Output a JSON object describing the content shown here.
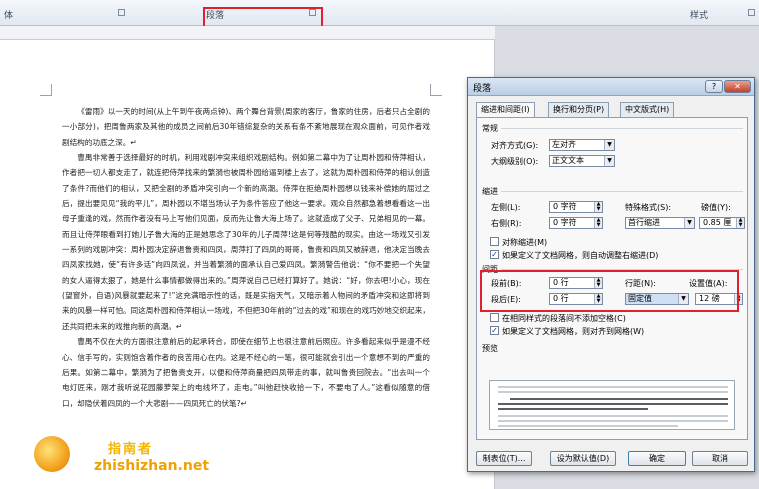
{
  "ribbon": {
    "left_label": "体",
    "para_label": "段落",
    "styles_label": "样式"
  },
  "document": {
    "paragraphs": [
      "《雷雨》以一天的时间(从上午到午夜两点钟)、两个舞台背景(周家的客厅，鲁家的住房，后者只占全剧的一小部分)，把周鲁两家及其他的成员之间前后30年错综复杂的关系有条不紊地展现在观众面前，可见作者戏剧结构的功底之深。↵",
      "曹禺非常善于选择最好的时机，利用戏剧冲突来组织戏剧结构。例如第二幕中为了让周朴园和侍萍相认，作者把一切人都支走了，就连把侍萍找来的繁漪也被周朴园给逼到楼上去了，这就为周朴园和侍萍的相认创造了条件?而他们的相认，又把全剧的矛盾冲突引向一个新的高潮。侍萍在拒绝周朴园想以钱来补偿她的屈过之后，提出要见见“我的平儿”，周朴园以不堪当场认子为条件答应了他这一要求。观众自然都急着想看看这一出母子重逢的戏，然而作者没有马上写他们见面，反而先让鲁大海上场了。这就造成了父子、兄弟相见的一幕。而且让侍萍眼看到打她儿子鲁大海的正是她思念了30年的儿子周萍!这是何等残酷的现实。由这一场戏又引发一系列的戏剧冲突：周朴园决定辞退鲁贵和四凤，周萍打了四凤的哥哥，鲁贵和四凤又被辞退，他决定当晚去四凤家找她，使“有许多话”向四凤说，并当着繁漪的面承认自己爱四凤。繁漪警告他说：“你不要把一个失望的女人逼得太狠了，她是什么事情都做得出来的。”周萍说自己已经打算好了。她说：“好，你去吧!小心，现在(望窗外，自语)风暴就要起来了!”这充满暗示性的话，既是实指天气，又暗示着人物间的矛盾冲突和这即将到来的风暴一样可怕。同这周朴园和侍萍相认一场戏，不但把30年前的“过去的戏”和现在的戏巧妙地交织起来，还共同把未来的戏推向新的高潮。↵",
      "曹禺不仅在大的方面很注意前后的起承转合，即使在细节上也很注意前后照应。许多看起来似乎是漫不经心、信手写的，实则饱含着作者的良苦用心在内。这是不经心的一笔，很可能就会引出一个意想不到的严重的后果。如第二幕中，繁漪为了把鲁贵支开，以便和侍萍商量把四凤带走的事，就叫鲁贵回院去。“出去叫一个电灯匠来，刚才我听说花园藤萝架上的电线坏了，走电。”叫他赶快收拾一下，不要电了人。”这看似随意的借口，却隐伏着四凤的一个大悲剧——四凤死亡的伏笔?↵"
    ]
  },
  "dialog": {
    "title": "段落",
    "help_glyph": "?",
    "close_glyph": "✕",
    "tabs": [
      "缩进和间距(I)",
      "换行和分页(P)",
      "中文版式(H)"
    ],
    "general": {
      "section": "常规",
      "alignment_label": "对齐方式(G):",
      "alignment_value": "左对齐",
      "outline_label": "大纲级别(O):",
      "outline_value": "正文文本"
    },
    "indent": {
      "section": "缩进",
      "left_label": "左侧(L):",
      "left_value": "0 字符",
      "right_label": "右侧(R):",
      "right_value": "0 字符",
      "special_label": "特殊格式(S):",
      "special_value": "首行缩进",
      "by_label": "磅值(Y):",
      "by_value": "0.85 厘",
      "mirror_label": "对称缩进(M)",
      "auto_adjust_label": "如果定义了文档网格，则自动调整右缩进(D)"
    },
    "spacing": {
      "section": "间距",
      "before_label": "段前(B):",
      "before_value": "0 行",
      "after_label": "段后(E):",
      "after_value": "0 行",
      "line_label": "行距(N):",
      "line_value": "固定值",
      "at_label": "设置值(A):",
      "at_value": "12 磅",
      "no_space_label": "在相同样式的段落间不添加空格(C)",
      "snap_label": "如果定义了文档网格，则对齐到网格(W)"
    },
    "preview_label": "预览",
    "buttons": {
      "tabs": "制表位(T)...",
      "default": "设为默认值(D)",
      "ok": "确定",
      "cancel": "取消"
    }
  },
  "watermark": {
    "cn": "指南者",
    "en": "zhishizhan.net"
  },
  "colors": {
    "highlight": "#e0202a",
    "dialog_bg": "#f0f0f0",
    "ribbon_bg": "#e2e8f0"
  }
}
